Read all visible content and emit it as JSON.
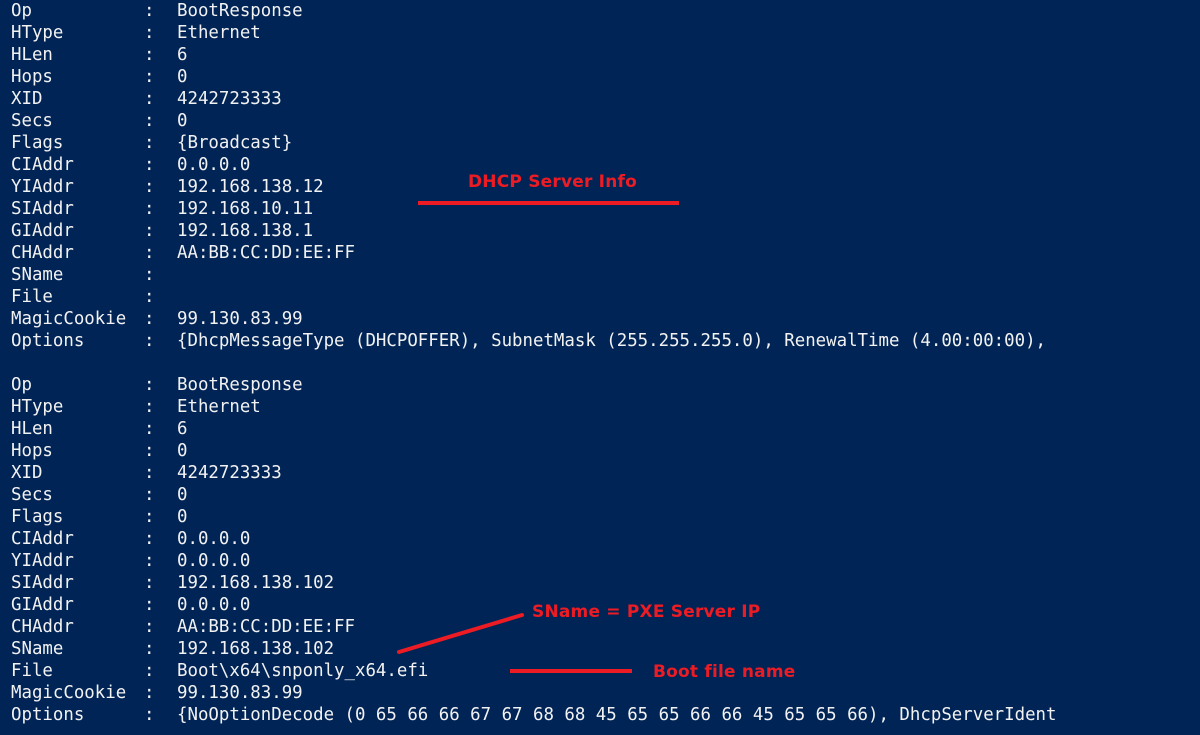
{
  "terminal": {
    "background_color": "#012456",
    "text_color": "#f2f2f2",
    "accent_color": "#ed1c24",
    "lines": [
      {
        "field": "Op",
        "sep": ":",
        "value": "BootResponse"
      },
      {
        "field": "HType",
        "sep": ":",
        "value": "Ethernet"
      },
      {
        "field": "HLen",
        "sep": ":",
        "value": "6"
      },
      {
        "field": "Hops",
        "sep": ":",
        "value": "0"
      },
      {
        "field": "XID",
        "sep": ":",
        "value": "4242723333"
      },
      {
        "field": "Secs",
        "sep": ":",
        "value": "0"
      },
      {
        "field": "Flags",
        "sep": ":",
        "value": "{Broadcast}"
      },
      {
        "field": "CIAddr",
        "sep": ":",
        "value": "0.0.0.0"
      },
      {
        "field": "YIAddr",
        "sep": ":",
        "value": "192.168.138.12"
      },
      {
        "field": "SIAddr",
        "sep": ":",
        "value": "192.168.10.11"
      },
      {
        "field": "GIAddr",
        "sep": ":",
        "value": "192.168.138.1"
      },
      {
        "field": "CHAddr",
        "sep": ":",
        "value": "AA:BB:CC:DD:EE:FF"
      },
      {
        "field": "SName",
        "sep": ":",
        "value": ""
      },
      {
        "field": "File",
        "sep": ":",
        "value": ""
      },
      {
        "field": "MagicCookie",
        "sep": ":",
        "value": "99.130.83.99"
      },
      {
        "field": "Options",
        "sep": ":",
        "value": "{DhcpMessageType (DHCPOFFER), SubnetMask (255.255.255.0), RenewalTime (4.00:00:00),"
      },
      {
        "field": "",
        "sep": "",
        "value": ""
      },
      {
        "field": "Op",
        "sep": ":",
        "value": "BootResponse"
      },
      {
        "field": "HType",
        "sep": ":",
        "value": "Ethernet"
      },
      {
        "field": "HLen",
        "sep": ":",
        "value": "6"
      },
      {
        "field": "Hops",
        "sep": ":",
        "value": "0"
      },
      {
        "field": "XID",
        "sep": ":",
        "value": "4242723333"
      },
      {
        "field": "Secs",
        "sep": ":",
        "value": "0"
      },
      {
        "field": "Flags",
        "sep": ":",
        "value": "0"
      },
      {
        "field": "CIAddr",
        "sep": ":",
        "value": "0.0.0.0"
      },
      {
        "field": "YIAddr",
        "sep": ":",
        "value": "0.0.0.0"
      },
      {
        "field": "SIAddr",
        "sep": ":",
        "value": "192.168.138.102"
      },
      {
        "field": "GIAddr",
        "sep": ":",
        "value": "0.0.0.0"
      },
      {
        "field": "CHAddr",
        "sep": ":",
        "value": "AA:BB:CC:DD:EE:FF"
      },
      {
        "field": "SName",
        "sep": ":",
        "value": "192.168.138.102"
      },
      {
        "field": "File",
        "sep": ":",
        "value": "Boot\\x64\\snponly_x64.efi"
      },
      {
        "field": "MagicCookie",
        "sep": ":",
        "value": "99.130.83.99"
      },
      {
        "field": "Options",
        "sep": ":",
        "value": "{NoOptionDecode (0 65 66 66 67 67 68 68 45 65 65 66 66 45 65 65 66), DhcpServerIdent"
      }
    ]
  },
  "annotations": [
    {
      "id": "dhcp-server-info",
      "label": "DHCP Server Info"
    },
    {
      "id": "sname-pxe-server-ip",
      "label": "SName = PXE Server IP"
    },
    {
      "id": "boot-file-name",
      "label": "Boot file name"
    }
  ]
}
